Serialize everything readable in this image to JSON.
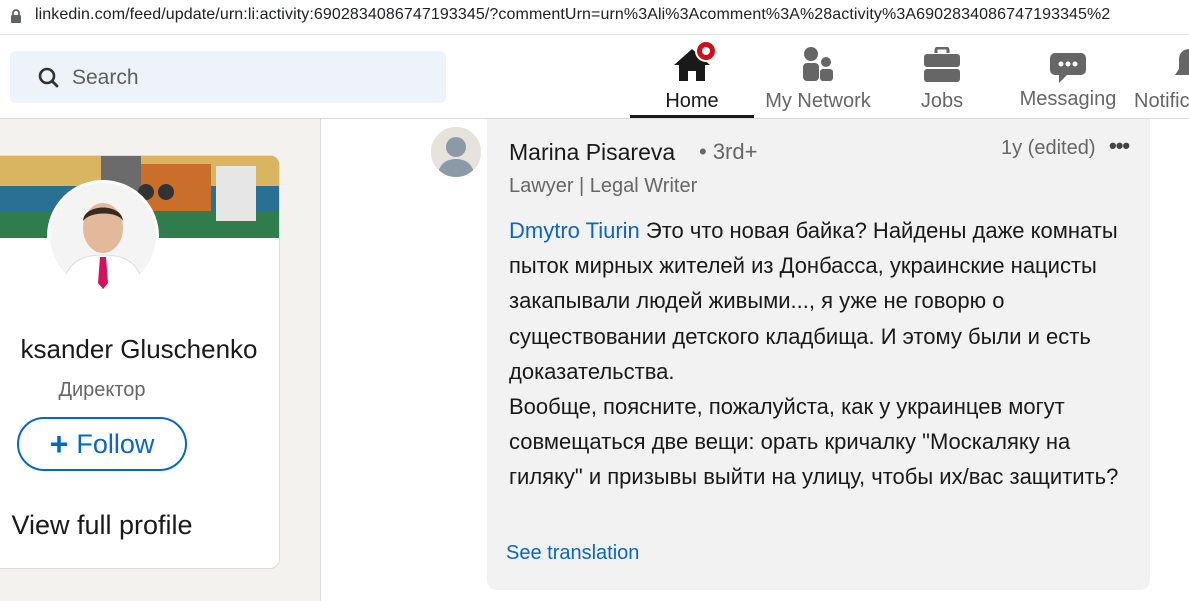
{
  "browser": {
    "url": "linkedin.com/feed/update/urn:li:activity:6902834086747193345/?commentUrn=urn%3Ali%3Acomment%3A%28activity%3A6902834086747193345%2"
  },
  "nav": {
    "search_placeholder": "Search",
    "items": [
      {
        "label": "Home",
        "icon": "home-icon"
      },
      {
        "label": "My Network",
        "icon": "network-icon"
      },
      {
        "label": "Jobs",
        "icon": "briefcase-icon"
      },
      {
        "label": "Messaging",
        "icon": "chat-icon"
      },
      {
        "label": "Notific",
        "icon": "bell-icon"
      }
    ],
    "active": "Home"
  },
  "profile_card": {
    "name": "ksander Gluschenko",
    "title": "Директор",
    "follow_label": "Follow",
    "view_profile_label": "View full profile"
  },
  "comment": {
    "author": "Marina Pisareva",
    "degree": "• 3rd+",
    "headline": "Lawyer | Legal Writer",
    "timestamp": "1y (edited)",
    "mention": "Dmytro Tiurin",
    "text": " Это что новая байка? Найдены даже комнаты пыток мирных жителей из Донбасса, украинские нацисты закапывали людей живыми..., я уже не говорю о существовании детского кладбища. И этому были и есть доказательства.",
    "text2": "Вообще, поясните, пожалуйста, как у украинцев могут совмещаться две вещи: орать кричалку \"Москаляку на гиляку\" и призывы выйти на улицу, чтобы их/вас защитить?",
    "see_translation": "See translation"
  },
  "colors": {
    "brand_blue": "#0a66c2",
    "notification_red": "#cc1016"
  }
}
